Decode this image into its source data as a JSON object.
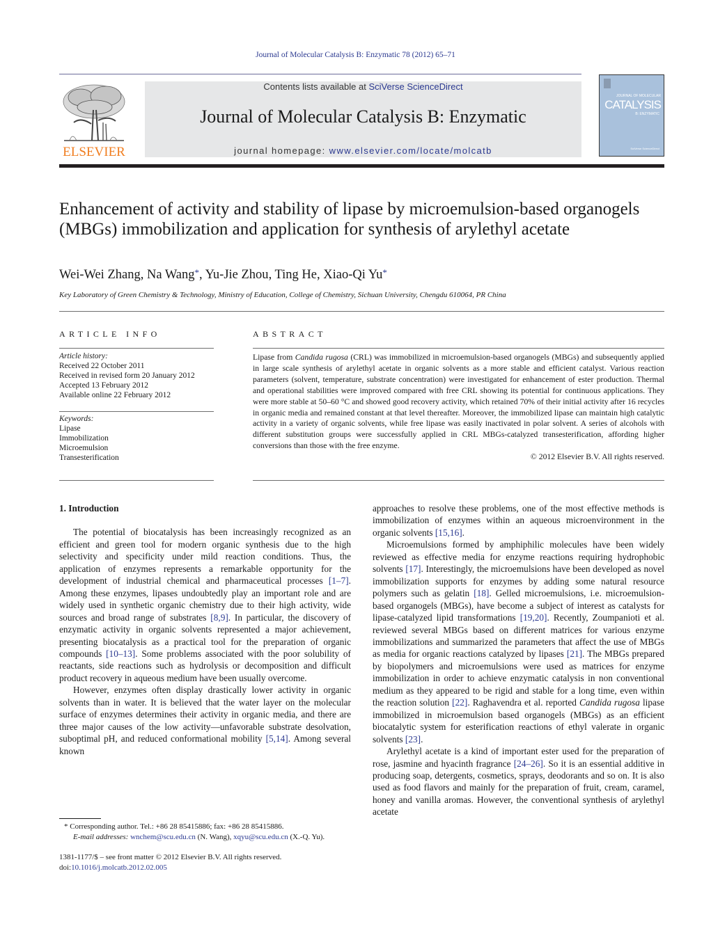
{
  "running_head": "Journal of Molecular Catalysis B: Enzymatic 78 (2012) 65–71",
  "masthead": {
    "publisher_logo_text": "ELSEVIER",
    "contents_prefix": "Contents lists available at ",
    "contents_link": "SciVerse ScienceDirect",
    "journal_name": "Journal of Molecular Catalysis B: Enzymatic",
    "homepage_prefix": "journal homepage: ",
    "homepage_link": "www.elsevier.com/locate/molcatb",
    "cover": {
      "top_text": "JOURNAL OF MOLECULAR",
      "title_text": "CATALYSIS",
      "sub_text": "B: ENZYMATIC",
      "foot_text": "SciVerse ScienceDirect",
      "bg_color": "#a9c1dc"
    },
    "colors": {
      "link": "#2b3990",
      "elsevier_orange": "#f07d1f",
      "band": "#e6e7e8"
    }
  },
  "article": {
    "title": "Enhancement of activity and stability of lipase by microemulsion-based organogels (MBGs) immobilization and application for synthesis of arylethyl acetate",
    "authors": [
      {
        "name": "Wei-Wei Zhang",
        "corresponding": false
      },
      {
        "name": "Na Wang",
        "corresponding": true
      },
      {
        "name": "Yu-Jie Zhou",
        "corresponding": false
      },
      {
        "name": "Ting He",
        "corresponding": false
      },
      {
        "name": "Xiao-Qi Yu",
        "corresponding": true
      }
    ],
    "author_separator": ", ",
    "corresponding_mark": "*",
    "affiliation": "Key Laboratory of Green Chemistry & Technology, Ministry of Education, College of Chemistry, Sichuan University, Chengdu 610064, PR China"
  },
  "article_info": {
    "heading": "ARTICLE INFO",
    "history_label": "Article history:",
    "history": [
      "Received 22 October 2011",
      "Received in revised form 20 January 2012",
      "Accepted 13 February 2012",
      "Available online 22 February 2012"
    ],
    "keywords_label": "Keywords:",
    "keywords": [
      "Lipase",
      "Immobilization",
      "Microemulsion",
      "Transesterification"
    ]
  },
  "abstract": {
    "heading": "ABSTRACT",
    "text_before_italic": "Lipase from ",
    "italic": "Candida rugosa",
    "text_after_italic": " (CRL) was immobilized in microemulsion-based organogels (MBGs) and subsequently applied in large scale synthesis of arylethyl acetate in organic solvents as a more stable and efficient catalyst. Various reaction parameters (solvent, temperature, substrate concentration) were investigated for enhancement of ester production. Thermal and operational stabilities were improved compared with free CRL showing its potential for continuous applications. They were more stable at 50–60 °C and showed good recovery activity, which retained 70% of their initial activity after 16 recycles in organic media and remained constant at that level thereafter. Moreover, the immobilized lipase can maintain high catalytic activity in a variety of organic solvents, while free lipase was easily inactivated in polar solvent. A series of alcohols with different substitution groups were successfully applied in CRL MBGs-catalyzed transesterification, affording higher conversions than those with the free enzyme.",
    "copyright": "© 2012 Elsevier B.V. All rights reserved."
  },
  "body": {
    "section_heading": "1.  Introduction",
    "left_paragraphs": [
      [
        {
          "t": "The potential of biocatalysis has been increasingly recognized as an efficient and green tool for modern organic synthesis due to the high selectivity and specificity under mild reaction conditions. Thus, the application of enzymes represents a remarkable opportunity for the development of industrial chemical and pharmaceutical processes "
        },
        {
          "ref": "[1–7]"
        },
        {
          "t": ". Among these enzymes, lipases undoubtedly play an important role and are widely used in synthetic organic chemistry due to their high activity, wide sources and broad range of substrates "
        },
        {
          "ref": "[8,9]"
        },
        {
          "t": ". In particular, the discovery of enzymatic activity in organic solvents represented a major achievement, presenting biocatalysis as a practical tool for the preparation of organic compounds "
        },
        {
          "ref": "[10–13]"
        },
        {
          "t": ". Some problems associated with the poor solubility of reactants, side reactions such as hydrolysis or decomposition and difficult product recovery in aqueous medium have been usually overcome."
        }
      ],
      [
        {
          "t": "However, enzymes often display drastically lower activity in organic solvents than in water. It is believed that the water layer on the molecular surface of enzymes determines their activity in organic media, and there are three major causes of the low activity—unfavorable substrate desolvation, suboptimal pH, and reduced conformational mobility "
        },
        {
          "ref": "[5,14]"
        },
        {
          "t": ". Among several known"
        }
      ]
    ],
    "right_paragraphs": [
      {
        "noindent": true,
        "runs": [
          {
            "t": "approaches to resolve these problems, one of the most effective methods is immobilization of enzymes within an aqueous microenvironment in the organic solvents "
          },
          {
            "ref": "[15,16]"
          },
          {
            "t": "."
          }
        ]
      },
      {
        "noindent": false,
        "runs": [
          {
            "t": "Microemulsions formed by amphiphilic molecules have been widely reviewed as effective media for enzyme reactions requiring hydrophobic solvents "
          },
          {
            "ref": "[17]"
          },
          {
            "t": ". Interestingly, the microemulsions have been developed as novel immobilization supports for enzymes by adding some natural resource polymers such as gelatin "
          },
          {
            "ref": "[18]"
          },
          {
            "t": ". Gelled microemulsions, i.e. microemulsion-based organogels (MBGs), have become a subject of interest as catalysts for lipase-catalyzed lipid transformations "
          },
          {
            "ref": "[19,20]"
          },
          {
            "t": ". Recently, Zoumpanioti et al. reviewed several MBGs based on different matrices for various enzyme immobilizations and summarized the parameters that affect the use of MBGs as media for organic reactions catalyzed by lipases "
          },
          {
            "ref": "[21]"
          },
          {
            "t": ". The MBGs prepared by biopolymers and microemulsions were used as matrices for enzyme immobilization in order to achieve enzymatic catalysis in non conventional medium as they appeared to be rigid and stable for a long time, even within the reaction solution "
          },
          {
            "ref": "[22]"
          },
          {
            "t": ". Raghavendra et al. reported "
          },
          {
            "i": "Candida rugosa"
          },
          {
            "t": " lipase immobilized in microemulsion based organogels (MBGs) as an efficient biocatalytic system for esterification reactions of ethyl valerate in organic solvents "
          },
          {
            "ref": "[23]"
          },
          {
            "t": "."
          }
        ]
      },
      {
        "noindent": false,
        "runs": [
          {
            "t": "Arylethyl acetate is a kind of important ester used for the preparation of rose, jasmine and hyacinth fragrance "
          },
          {
            "ref": "[24–26]"
          },
          {
            "t": ". So it is an essential additive in producing soap, detergents, cosmetics, sprays, deodorants and so on. It is also used as food flavors and mainly for the preparation of fruit, cream, caramel, honey and vanilla aromas. However, the conventional synthesis of arylethyl acetate"
          }
        ]
      }
    ]
  },
  "footnote": {
    "mark": "*",
    "line1": " Corresponding author. Tel.: +86 28 85415886; fax: +86 28 85415886.",
    "email_label": "E-mail addresses:",
    "email1": "wnchem@scu.edu.cn",
    "email1_owner": " (N. Wang), ",
    "email2": "xqyu@scu.edu.cn",
    "email2_owner": " (X.-Q. Yu)."
  },
  "front_matter": {
    "issn_line": "1381-1177/$ – see front matter © 2012 Elsevier B.V. All rights reserved.",
    "doi_prefix": "doi:",
    "doi": "10.1016/j.molcatb.2012.02.005"
  }
}
